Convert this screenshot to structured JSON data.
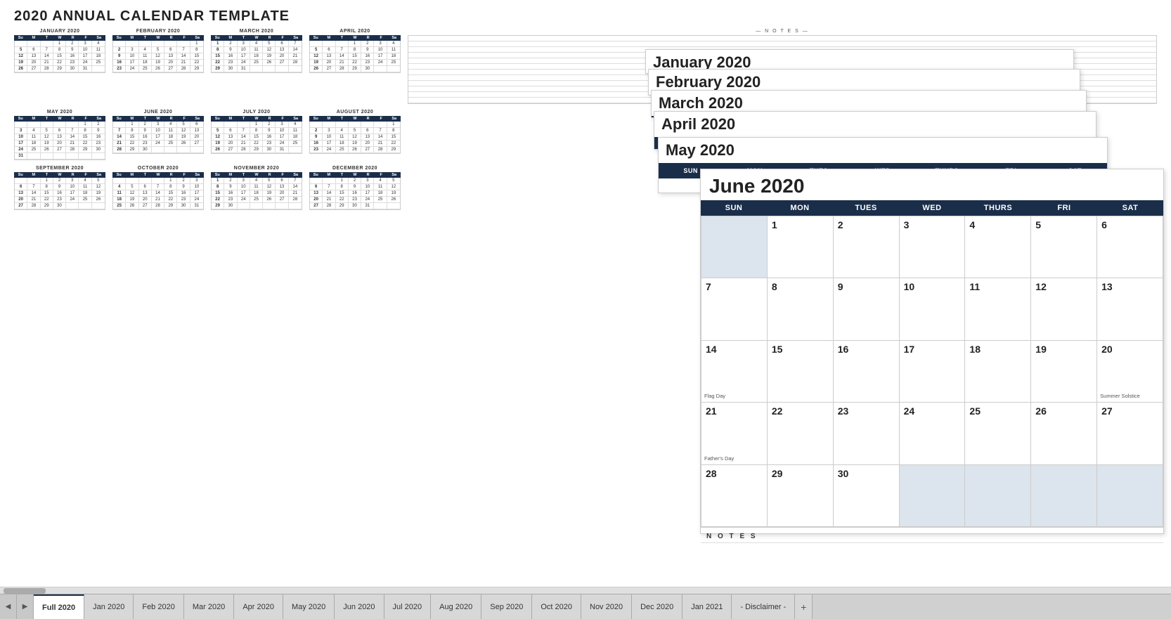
{
  "title": "2020 ANNUAL CALENDAR TEMPLATE",
  "months": [
    {
      "name": "JANUARY 2020",
      "header": [
        "Su",
        "M",
        "T",
        "W",
        "R",
        "F",
        "Sa"
      ],
      "weeks": [
        [
          "",
          "",
          "",
          "1",
          "2",
          "3",
          "4"
        ],
        [
          "5",
          "6",
          "7",
          "8",
          "9",
          "10",
          "11"
        ],
        [
          "12",
          "13",
          "14",
          "15",
          "16",
          "17",
          "18"
        ],
        [
          "19",
          "20",
          "21",
          "22",
          "23",
          "24",
          "25"
        ],
        [
          "26",
          "27",
          "28",
          "29",
          "30",
          "31",
          ""
        ]
      ]
    },
    {
      "name": "FEBRUARY 2020",
      "header": [
        "Su",
        "M",
        "T",
        "W",
        "R",
        "F",
        "Sa"
      ],
      "weeks": [
        [
          "",
          "",
          "",
          "",
          "",
          "",
          "1"
        ],
        [
          "2",
          "3",
          "4",
          "5",
          "6",
          "7",
          "8"
        ],
        [
          "9",
          "10",
          "11",
          "12",
          "13",
          "14",
          "15"
        ],
        [
          "16",
          "17",
          "18",
          "19",
          "20",
          "21",
          "22"
        ],
        [
          "23",
          "24",
          "25",
          "26",
          "27",
          "28",
          "29"
        ]
      ]
    },
    {
      "name": "MARCH 2020",
      "header": [
        "Su",
        "M",
        "T",
        "W",
        "R",
        "F",
        "Sa"
      ],
      "weeks": [
        [
          "1",
          "2",
          "3",
          "4",
          "5",
          "6",
          "7"
        ],
        [
          "8",
          "9",
          "10",
          "11",
          "12",
          "13",
          "14"
        ],
        [
          "15",
          "16",
          "17",
          "18",
          "19",
          "20",
          "21"
        ],
        [
          "22",
          "23",
          "24",
          "25",
          "26",
          "27",
          "28"
        ],
        [
          "29",
          "30",
          "31",
          "",
          "",
          "",
          ""
        ]
      ]
    },
    {
      "name": "APRIL 2020",
      "header": [
        "Su",
        "M",
        "T",
        "W",
        "R",
        "F",
        "Sa"
      ],
      "weeks": [
        [
          "",
          "",
          "",
          "1",
          "2",
          "3",
          "4"
        ],
        [
          "5",
          "6",
          "7",
          "8",
          "9",
          "10",
          "11"
        ],
        [
          "12",
          "13",
          "14",
          "15",
          "16",
          "17",
          "18"
        ],
        [
          "19",
          "20",
          "21",
          "22",
          "23",
          "24",
          "25"
        ],
        [
          "26",
          "27",
          "28",
          "29",
          "30",
          "",
          ""
        ]
      ]
    },
    {
      "name": "MAY 2020",
      "header": [
        "Su",
        "M",
        "T",
        "W",
        "R",
        "F",
        "Sa"
      ],
      "weeks": [
        [
          "",
          "",
          "",
          "",
          "",
          "1",
          "2"
        ],
        [
          "3",
          "4",
          "5",
          "6",
          "7",
          "8",
          "9"
        ],
        [
          "10",
          "11",
          "12",
          "13",
          "14",
          "15",
          "16"
        ],
        [
          "17",
          "18",
          "19",
          "20",
          "21",
          "22",
          "23"
        ],
        [
          "24",
          "25",
          "26",
          "27",
          "28",
          "29",
          "30"
        ],
        [
          "31",
          "",
          "",
          "",
          "",
          "",
          ""
        ]
      ]
    },
    {
      "name": "JUNE 2020",
      "header": [
        "Su",
        "M",
        "T",
        "W",
        "R",
        "F",
        "Sa"
      ],
      "weeks": [
        [
          "",
          "1",
          "2",
          "3",
          "4",
          "5",
          "6"
        ],
        [
          "7",
          "8",
          "9",
          "10",
          "11",
          "12",
          "13"
        ],
        [
          "14",
          "15",
          "16",
          "17",
          "18",
          "19",
          "20"
        ],
        [
          "21",
          "22",
          "23",
          "24",
          "25",
          "26",
          "27"
        ],
        [
          "28",
          "29",
          "30",
          "",
          "",
          "",
          ""
        ]
      ],
      "holidays": {
        "14": "Flag Day",
        "20": "Summer Solstice",
        "21": "Father's Day"
      }
    },
    {
      "name": "JULY 2020",
      "header": [
        "Su",
        "M",
        "T",
        "W",
        "R",
        "F",
        "Sa"
      ],
      "weeks": [
        [
          "",
          "",
          "",
          "1",
          "2",
          "3",
          "4"
        ],
        [
          "5",
          "6",
          "7",
          "8",
          "9",
          "10",
          "11"
        ],
        [
          "12",
          "13",
          "14",
          "15",
          "16",
          "17",
          "18"
        ],
        [
          "19",
          "20",
          "21",
          "22",
          "23",
          "24",
          "25"
        ],
        [
          "26",
          "27",
          "28",
          "29",
          "30",
          "31",
          ""
        ]
      ]
    },
    {
      "name": "AUGUST 2020",
      "header": [
        "Su",
        "M",
        "T",
        "W",
        "R",
        "F",
        "Sa"
      ],
      "weeks": [
        [
          "",
          "",
          "",
          "",
          "",
          "",
          "1"
        ],
        [
          "2",
          "3",
          "4",
          "5",
          "6",
          "7",
          "8"
        ],
        [
          "9",
          "10",
          "11",
          "12",
          "13",
          "14",
          "15"
        ],
        [
          "16",
          "17",
          "18",
          "19",
          "20",
          "21",
          "22"
        ],
        [
          "23",
          "24",
          "25",
          "26",
          "27",
          "28",
          "29"
        ]
      ]
    },
    {
      "name": "SEPTEMBER 2020",
      "header": [
        "Su",
        "M",
        "T",
        "W",
        "R",
        "F",
        "Sa"
      ],
      "weeks": [
        [
          "",
          "",
          "1",
          "2",
          "3",
          "4",
          "5"
        ],
        [
          "6",
          "7",
          "8",
          "9",
          "10",
          "11",
          "12"
        ],
        [
          "13",
          "14",
          "15",
          "16",
          "17",
          "18",
          "19"
        ],
        [
          "20",
          "21",
          "22",
          "23",
          "24",
          "25",
          "26"
        ],
        [
          "27",
          "28",
          "29",
          "30",
          "",
          "",
          ""
        ]
      ]
    },
    {
      "name": "OCTOBER 2020",
      "header": [
        "Su",
        "M",
        "T",
        "W",
        "R",
        "F",
        "Sa"
      ],
      "weeks": [
        [
          "",
          "",
          "",
          "",
          "1",
          "2",
          "3"
        ],
        [
          "4",
          "5",
          "6",
          "7",
          "8",
          "9",
          "10"
        ],
        [
          "11",
          "12",
          "13",
          "14",
          "15",
          "16",
          "17"
        ],
        [
          "18",
          "19",
          "20",
          "21",
          "22",
          "23",
          "24"
        ],
        [
          "25",
          "26",
          "27",
          "28",
          "29",
          "30",
          "31"
        ]
      ]
    },
    {
      "name": "NOVEMBER 2020",
      "header": [
        "Su",
        "M",
        "T",
        "W",
        "R",
        "F",
        "Sa"
      ],
      "weeks": [
        [
          "1",
          "2",
          "3",
          "4",
          "5",
          "6",
          "7"
        ],
        [
          "8",
          "9",
          "10",
          "11",
          "12",
          "13",
          "14"
        ],
        [
          "15",
          "16",
          "17",
          "18",
          "19",
          "20",
          "21"
        ],
        [
          "22",
          "23",
          "24",
          "25",
          "26",
          "27",
          "28"
        ],
        [
          "29",
          "30",
          "",
          "",
          "",
          "",
          ""
        ]
      ]
    },
    {
      "name": "DECEMBER 2020",
      "header": [
        "Su",
        "M",
        "T",
        "W",
        "R",
        "F",
        "Sa"
      ],
      "weeks": [
        [
          "",
          "",
          "1",
          "2",
          "3",
          "4",
          "5"
        ],
        [
          "6",
          "7",
          "8",
          "9",
          "10",
          "11",
          "12"
        ],
        [
          "13",
          "14",
          "15",
          "16",
          "17",
          "18",
          "19"
        ],
        [
          "20",
          "21",
          "22",
          "23",
          "24",
          "25",
          "26"
        ],
        [
          "27",
          "28",
          "29",
          "30",
          "31",
          "",
          ""
        ]
      ]
    }
  ],
  "notes_label": "— N O T E S —",
  "stacked_cards": [
    {
      "title": "January 2020"
    },
    {
      "title": "February 2020"
    },
    {
      "title": "March 2020"
    },
    {
      "title": "April 2020"
    },
    {
      "title": "May 2020"
    }
  ],
  "june_title": "June 2020",
  "june_header": [
    "SUN",
    "MON",
    "TUES",
    "WED",
    "THURS",
    "FRI",
    "SAT"
  ],
  "tabs": [
    {
      "label": "Full 2020",
      "active": true
    },
    {
      "label": "Jan 2020"
    },
    {
      "label": "Feb 2020"
    },
    {
      "label": "Mar 2020"
    },
    {
      "label": "Apr 2020"
    },
    {
      "label": "May 2020"
    },
    {
      "label": "Jun 2020"
    },
    {
      "label": "Jul 2020"
    },
    {
      "label": "Aug 2020"
    },
    {
      "label": "Sep 2020"
    },
    {
      "label": "Oct 2020"
    },
    {
      "label": "Nov 2020"
    },
    {
      "label": "Dec 2020"
    },
    {
      "label": "Jan 2021"
    },
    {
      "label": "- Disclaimer -"
    }
  ],
  "colors": {
    "dark_navy": "#1a2e4a",
    "light_blue_empty": "#c8d5e0",
    "white": "#ffffff"
  }
}
